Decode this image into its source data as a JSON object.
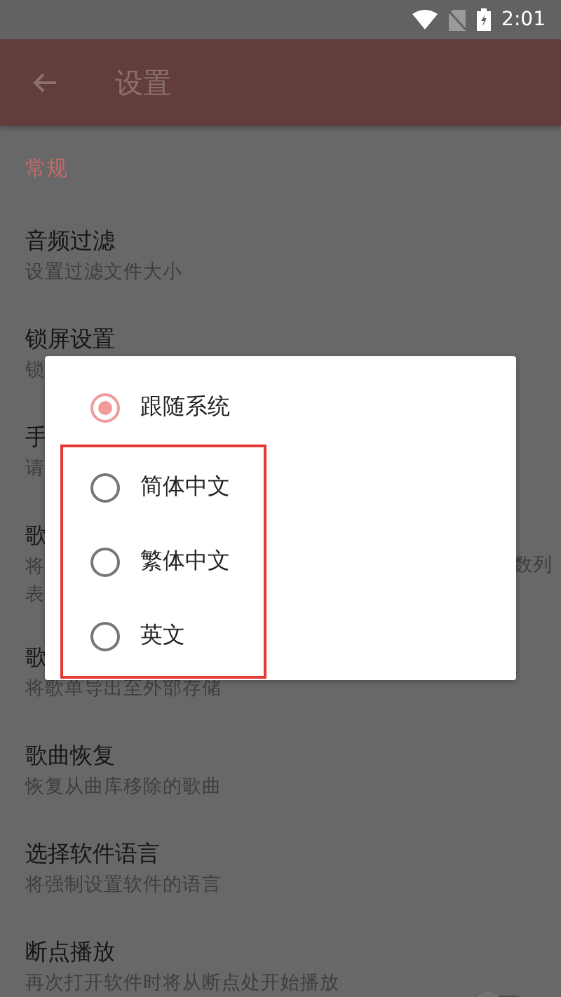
{
  "status_bar": {
    "time": "2:01"
  },
  "toolbar": {
    "title": "设置"
  },
  "section": "常规",
  "rows": [
    {
      "title": "音频过滤",
      "subtitle": [
        "设置过滤文件大小"
      ]
    },
    {
      "title": "锁屏设置",
      "subtitle": [
        "锁"
      ]
    },
    {
      "title": "手",
      "subtitle": [
        "请"
      ]
    },
    {
      "title": "歌",
      "subtitle": [
        "将",
        "表"
      ],
      "subtitle_tail": "数列"
    },
    {
      "title": "歌",
      "subtitle": [
        "将歌单导出至外部存储"
      ]
    },
    {
      "title": "歌曲恢复",
      "subtitle": [
        "恢复从曲库移除的歌曲"
      ]
    },
    {
      "title": "选择软件语言",
      "subtitle": [
        "将强制设置软件的语言"
      ]
    },
    {
      "title": "断点播放",
      "subtitle": [
        "再次打开软件时将从断点处开始播放"
      ],
      "toggle": {
        "on": false
      }
    }
  ],
  "dialog": {
    "options": [
      {
        "label": "跟随系统",
        "selected": true,
        "highlighted": false
      },
      {
        "label": "简体中文",
        "selected": false,
        "highlighted": true
      },
      {
        "label": "繁体中文",
        "selected": false,
        "highlighted": true
      },
      {
        "label": "英文",
        "selected": false,
        "highlighted": true
      }
    ]
  }
}
